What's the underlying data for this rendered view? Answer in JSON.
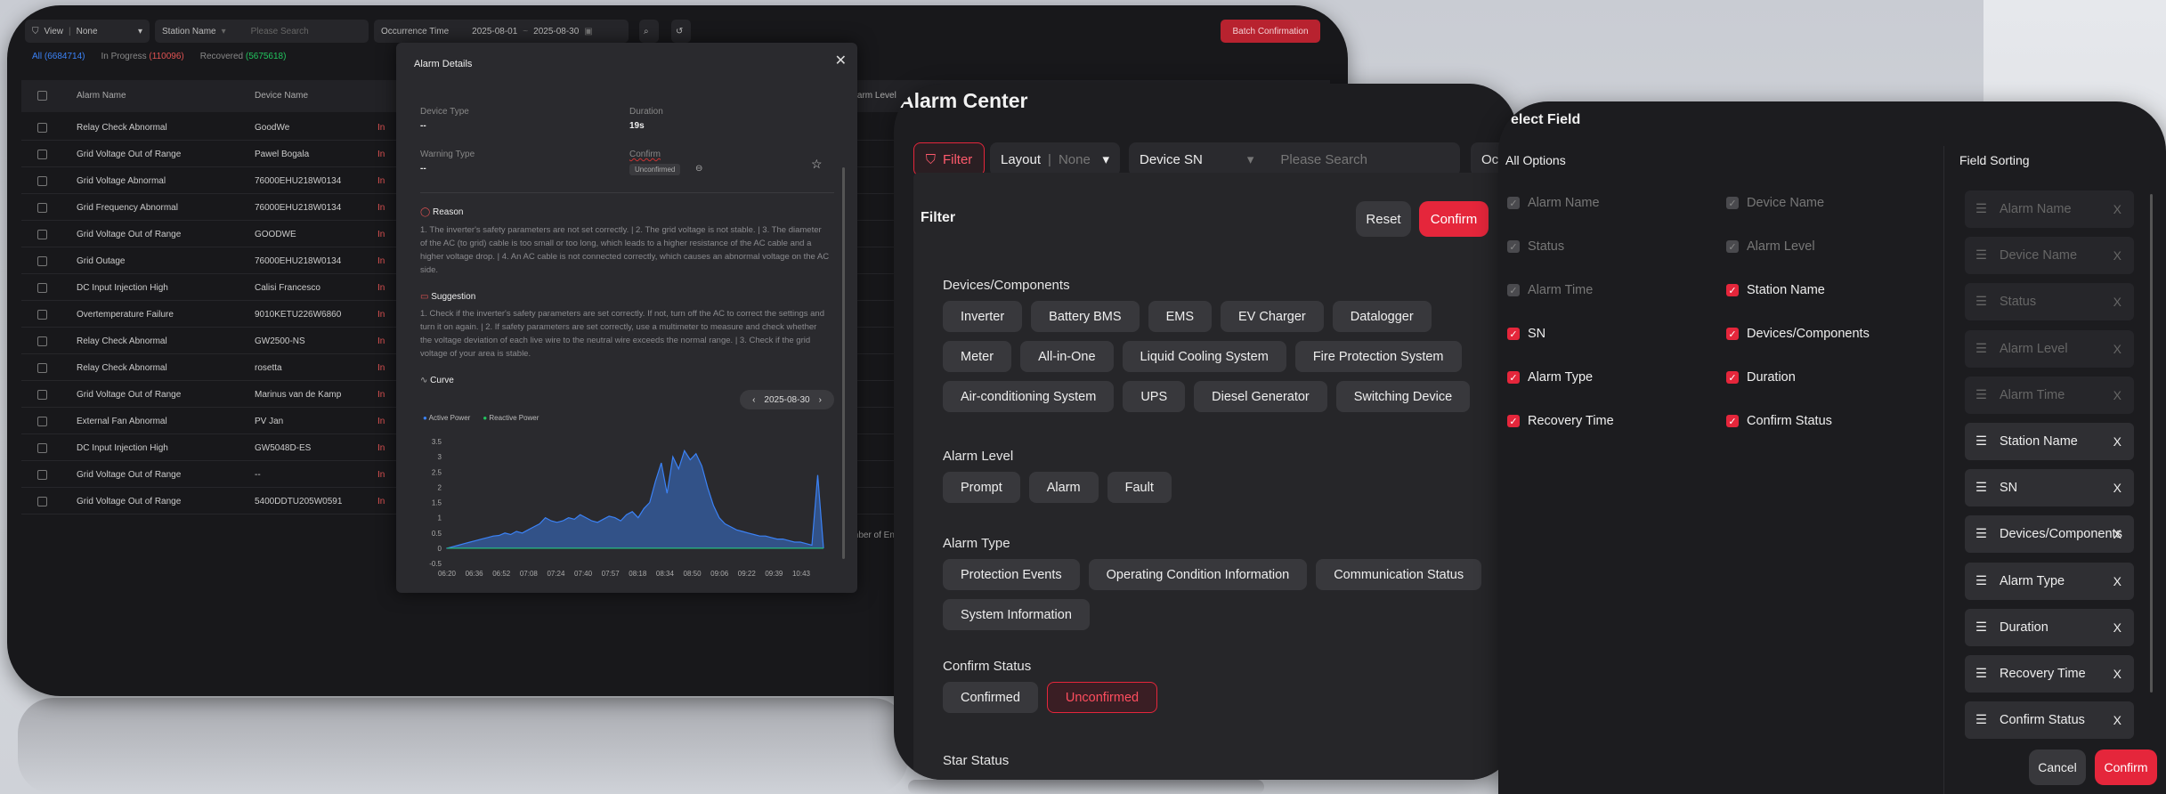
{
  "window_a": {
    "toolbar": {
      "view_label": "View",
      "view_value": "None",
      "station_label": "Station Name",
      "search_placeholder": "Please Search",
      "time_label": "Occurrence Time",
      "date_start": "2025-08-01",
      "date_end": "2025-08-30",
      "batch_button": "Batch Confirmation"
    },
    "tabs": {
      "all_label": "All",
      "all_count": "(6684714)",
      "progress_label": "In Progress",
      "progress_count": "(110096)",
      "recovered_label": "Recovered",
      "recovered_count": "(5675618)"
    },
    "columns": {
      "alarm_name": "Alarm Name",
      "device_name": "Device Name",
      "alarm_level": "Alarm Level"
    },
    "rows": [
      {
        "alarm": "Relay Check Abnormal",
        "device": "GoodWe",
        "status": "In"
      },
      {
        "alarm": "Grid Voltage Out of Range",
        "device": "Pawel Bogala",
        "status": "In"
      },
      {
        "alarm": "Grid Voltage Abnormal",
        "device": "76000EHU218W0134",
        "status": "In"
      },
      {
        "alarm": "Grid Frequency Abnormal",
        "device": "76000EHU218W0134",
        "status": "In"
      },
      {
        "alarm": "Grid Voltage Out of Range",
        "device": "GOODWE",
        "status": "In"
      },
      {
        "alarm": "Grid Outage",
        "device": "76000EHU218W0134",
        "status": "In"
      },
      {
        "alarm": "DC Input Injection High",
        "device": "Calisi Francesco",
        "status": "In"
      },
      {
        "alarm": "Overtemperature Failure",
        "device": "9010KETU226W6860",
        "status": "In"
      },
      {
        "alarm": "Relay Check Abnormal",
        "device": "GW2500-NS",
        "status": "In"
      },
      {
        "alarm": "Relay Check Abnormal",
        "device": "rosetta",
        "status": "In"
      },
      {
        "alarm": "Grid Voltage Out of Range",
        "device": "Marinus van de Kamp",
        "status": "In"
      },
      {
        "alarm": "External Fan Abnormal",
        "device": "PV Jan",
        "status": "In"
      },
      {
        "alarm": "DC Input Injection High",
        "device": "GW5048D-ES",
        "status": "In"
      },
      {
        "alarm": "Grid Voltage Out of Range",
        "device": "--",
        "status": "In"
      },
      {
        "alarm": "Grid Voltage Out of Range",
        "device": "5400DDTU205W0591",
        "status": "In"
      }
    ],
    "footer_fragment": "mber of En"
  },
  "alarm_details": {
    "title": "Alarm Details",
    "device_type_label": "Device Type",
    "device_type_value": "--",
    "duration_label": "Duration",
    "duration_value": "19s",
    "warning_type_label": "Warning Type",
    "warning_type_value": "--",
    "confirm_label": "Confirm",
    "confirm_badge": "Unconfirmed",
    "reason_title": "Reason",
    "reason_text": "1. The inverter's safety parameters are not set correctly. | 2. The grid voltage is not stable. | 3. The diameter of the AC (to grid) cable is too small or too long, which leads to a higher resistance of the AC cable and a higher voltage drop. | 4. An AC cable is not connected correctly, which causes an abnormal voltage on the AC side.",
    "suggestion_title": "Suggestion",
    "suggestion_text": "1. Check if the inverter's safety parameters are set correctly. If not, turn off the AC to correct the settings and turn it on again. | 2. If safety parameters are set correctly, use a multimeter to measure and check whether the voltage deviation of each live wire to the neutral wire exceeds the normal range. | 3. Check if the grid voltage of your area is stable.",
    "curve_title": "Curve",
    "curve_date": "2025-08-30"
  },
  "chart_data": {
    "type": "area",
    "series": [
      {
        "name": "Active Power",
        "color": "#3b82f6"
      },
      {
        "name": "Reactive Power",
        "color": "#22c55e"
      }
    ],
    "x_ticks": [
      "06:20",
      "06:36",
      "06:52",
      "07:08",
      "07:24",
      "07:40",
      "07:57",
      "08:18",
      "08:34",
      "08:50",
      "09:06",
      "09:22",
      "09:39",
      "10:43"
    ],
    "y_ticks": [
      "3.5",
      "3",
      "2.5",
      "2",
      "1.5",
      "1",
      "0.5",
      "0",
      "-0.5"
    ],
    "ylim": [
      -0.5,
      3.5
    ],
    "x": [
      0,
      0.2,
      0.4,
      0.6,
      0.8,
      1,
      1.2,
      1.4,
      1.6,
      1.8,
      2,
      2.2,
      2.4,
      2.6,
      2.8,
      3,
      3.2,
      3.4,
      3.6,
      3.8,
      4,
      4.2,
      4.4,
      4.6,
      4.8,
      5,
      5.2,
      5.4,
      5.6,
      5.8,
      6,
      6.2,
      6.4,
      6.6,
      6.8,
      7,
      7.2,
      7.4,
      7.6,
      7.8,
      8,
      8.2,
      8.4,
      8.6,
      8.8,
      9,
      9.2,
      9.4,
      9.6,
      9.8,
      10,
      10.2,
      10.4,
      10.6,
      10.8,
      11,
      11.2,
      11.4,
      11.6,
      11.8,
      12,
      12.2,
      12.4,
      12.6,
      12.8,
      13
    ],
    "active_values": [
      0,
      0.05,
      0.1,
      0.15,
      0.2,
      0.25,
      0.3,
      0.35,
      0.4,
      0.42,
      0.5,
      0.45,
      0.55,
      0.5,
      0.6,
      0.7,
      0.8,
      1.0,
      0.9,
      0.85,
      0.9,
      1.0,
      0.95,
      1.1,
      1.0,
      0.9,
      0.85,
      0.95,
      1.05,
      1.0,
      0.9,
      1.1,
      1.2,
      1.0,
      1.3,
      1.5,
      2.2,
      2.8,
      1.8,
      3.0,
      2.6,
      3.2,
      2.9,
      3.1,
      2.7,
      2.0,
      1.4,
      1.0,
      0.8,
      0.7,
      0.6,
      0.55,
      0.5,
      0.45,
      0.4,
      0.4,
      0.35,
      0.3,
      0.3,
      0.25,
      0.2,
      0.2,
      0.15,
      0.1,
      2.4,
      0
    ],
    "reactive_values": [
      0,
      0,
      0,
      0,
      0,
      0,
      0,
      0,
      0,
      0,
      0,
      0,
      0,
      0,
      0,
      0,
      0,
      0,
      0,
      0,
      0,
      0,
      0,
      0,
      0,
      0,
      0,
      0,
      0,
      0,
      0,
      0,
      0,
      0,
      0,
      0,
      0,
      0,
      0,
      0,
      0,
      0,
      0,
      0,
      0,
      0,
      0,
      0,
      0,
      0,
      0,
      0,
      0,
      0,
      0,
      0,
      0,
      0,
      0,
      0,
      0,
      0,
      0,
      0,
      0,
      0
    ]
  },
  "alarm_center": {
    "title": "Alarm Center",
    "filter_button": "Filter",
    "layout_label": "Layout",
    "layout_value": "None",
    "sn_label": "Device SN",
    "search_placeholder": "Please Search",
    "occ_fragment": "Occ",
    "panel_title": "Filter",
    "reset_button": "Reset",
    "confirm_button": "Confirm",
    "groups": [
      {
        "title": "Devices/Components",
        "chips": [
          "Inverter",
          "Battery BMS",
          "EMS",
          "EV Charger",
          "Datalogger",
          "Meter",
          "All-in-One",
          "Liquid Cooling System",
          "Fire Protection System",
          "Air-conditioning System",
          "UPS",
          "Diesel Generator",
          "Switching Device"
        ]
      },
      {
        "title": "Alarm Level",
        "chips": [
          "Prompt",
          "Alarm",
          "Fault"
        ]
      },
      {
        "title": "Alarm Type",
        "chips": [
          "Protection Events",
          "Operating Condition Information",
          "Communication Status",
          "System Information"
        ]
      },
      {
        "title": "Confirm Status",
        "chips": [
          "Confirmed",
          "Unconfirmed"
        ]
      }
    ],
    "star_status": "Star Status"
  },
  "select_field": {
    "title": "elect Field",
    "all_options_label": "All Options",
    "field_sorting_label": "Field Sorting",
    "options_left": [
      {
        "label": "Alarm Name",
        "state": "disabled"
      },
      {
        "label": "Status",
        "state": "disabled"
      },
      {
        "label": "Alarm Time",
        "state": "disabled"
      },
      {
        "label": "SN",
        "state": "checked"
      },
      {
        "label": "Alarm Type",
        "state": "checked"
      },
      {
        "label": "Recovery Time",
        "state": "checked"
      }
    ],
    "options_right": [
      {
        "label": "Device Name",
        "state": "disabled"
      },
      {
        "label": "Alarm Level",
        "state": "disabled"
      },
      {
        "label": "Station Name",
        "state": "checked"
      },
      {
        "label": "Devices/Components",
        "state": "checked"
      },
      {
        "label": "Duration",
        "state": "checked"
      },
      {
        "label": "Confirm Status",
        "state": "checked"
      }
    ],
    "sorting": [
      {
        "label": "Alarm Name",
        "state": "disabled"
      },
      {
        "label": "Device Name",
        "state": "disabled"
      },
      {
        "label": "Status",
        "state": "disabled"
      },
      {
        "label": "Alarm Level",
        "state": "disabled"
      },
      {
        "label": "Alarm Time",
        "state": "disabled"
      },
      {
        "label": "Station Name",
        "state": "active"
      },
      {
        "label": "SN",
        "state": "active"
      },
      {
        "label": "Devices/Components",
        "state": "active"
      },
      {
        "label": "Alarm Type",
        "state": "active"
      },
      {
        "label": "Duration",
        "state": "active"
      },
      {
        "label": "Recovery Time",
        "state": "active"
      },
      {
        "label": "Confirm Status",
        "state": "active"
      }
    ],
    "remove_glyph": "X",
    "cancel_button": "Cancel",
    "confirm_button": "Confirm"
  },
  "colors": {
    "accent": "#e5263b",
    "blue": "#3b82f6",
    "green": "#22c55e"
  }
}
